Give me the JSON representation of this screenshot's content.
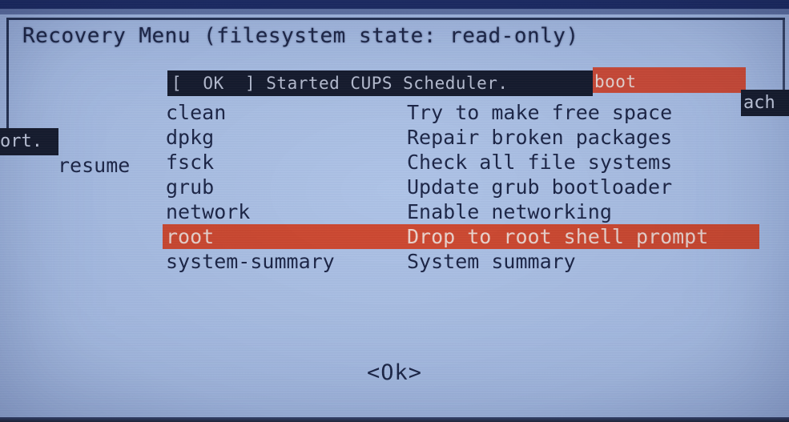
{
  "window": {
    "title": "Recovery Menu (filesystem state: read-only)",
    "background_color": "#aec3e6",
    "text_color": "#1b2445",
    "highlight_color": "#d0482f",
    "overlay_dark_color": "#141a2c"
  },
  "overlay": {
    "boot_message": "[  OK  ] Started CUPS Scheduler.",
    "boot_message_red": "boot",
    "fragment_right": "ach",
    "fragment_left": "ort.",
    "stray_word": "resume"
  },
  "menu": {
    "selected_index": 5,
    "items": [
      {
        "key": "clean",
        "description": "Try to make free space"
      },
      {
        "key": "dpkg",
        "description": "Repair broken packages"
      },
      {
        "key": "fsck",
        "description": "Check all file systems"
      },
      {
        "key": "grub",
        "description": "Update grub bootloader"
      },
      {
        "key": "network",
        "description": "Enable networking"
      },
      {
        "key": "root",
        "description": "Drop to root shell prompt"
      },
      {
        "key": "system-summary",
        "description": "System summary"
      }
    ]
  },
  "buttons": {
    "ok_label": "<Ok>"
  }
}
